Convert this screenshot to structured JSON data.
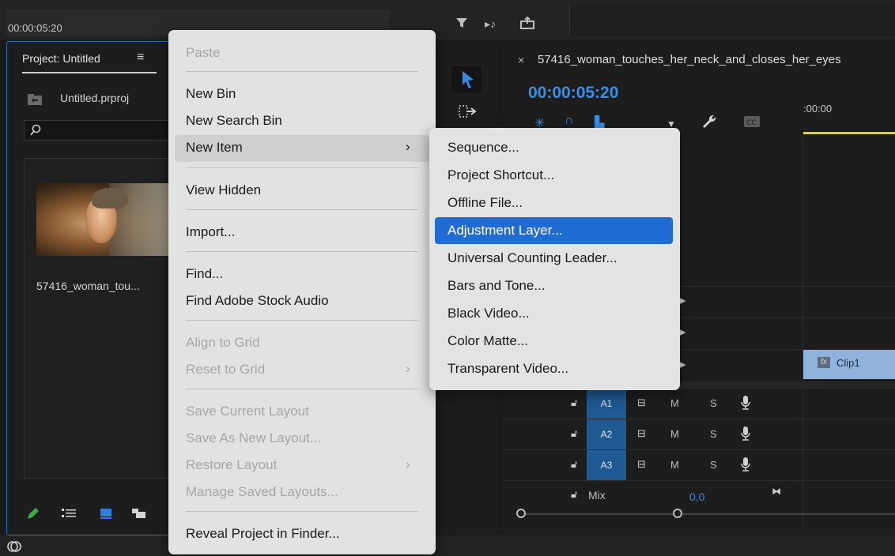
{
  "topbar": {
    "timecode": "00:00:05:20"
  },
  "project": {
    "tab_title": "Project: Untitled",
    "file_name": "Untitled.prproj",
    "clip_label": "57416_woman_tou..."
  },
  "timeline": {
    "sequence_name": "57416_woman_touches_her_neck_and_closes_her_eyes",
    "timecode": "00:00:05:20",
    "ruler_start": ":00:00",
    "audio_tracks": [
      "A1",
      "A2",
      "A3"
    ],
    "mute_label": "M",
    "solo_label": "S",
    "mix_label": "Mix",
    "mix_value": "0,0",
    "clip_name": "Clip1"
  },
  "context_menu": {
    "items": [
      {
        "label": "Paste",
        "disabled": true
      },
      {
        "label": "New Bin",
        "disabled": false
      },
      {
        "label": "New Search Bin",
        "disabled": false
      },
      {
        "label": "New Item",
        "disabled": false,
        "submenu": true,
        "highlighted": true
      },
      {
        "label": "View Hidden",
        "disabled": false
      },
      {
        "label": "Import...",
        "disabled": false
      },
      {
        "label": "Find...",
        "disabled": false
      },
      {
        "label": "Find Adobe Stock Audio",
        "disabled": false
      },
      {
        "label": "Align to Grid",
        "disabled": true
      },
      {
        "label": "Reset to Grid",
        "disabled": true,
        "submenu": true
      },
      {
        "label": "Save Current Layout",
        "disabled": true
      },
      {
        "label": "Save As New Layout...",
        "disabled": true
      },
      {
        "label": "Restore Layout",
        "disabled": true,
        "submenu": true
      },
      {
        "label": "Manage Saved Layouts...",
        "disabled": true
      },
      {
        "label": "Reveal Project in Finder...",
        "disabled": false
      }
    ]
  },
  "submenu": {
    "items": [
      "Sequence...",
      "Project Shortcut...",
      "Offline File...",
      "Adjustment Layer...",
      "Universal Counting Leader...",
      "Bars and Tone...",
      "Black Video...",
      "Color Matte...",
      "Transparent Video..."
    ],
    "selected": "Adjustment Layer..."
  },
  "colors": {
    "accent_blue": "#1f6dd4",
    "timecode_blue": "#3a8ee6",
    "track_blue": "#1f5a93",
    "playhead_yellow": "#e6d600"
  }
}
